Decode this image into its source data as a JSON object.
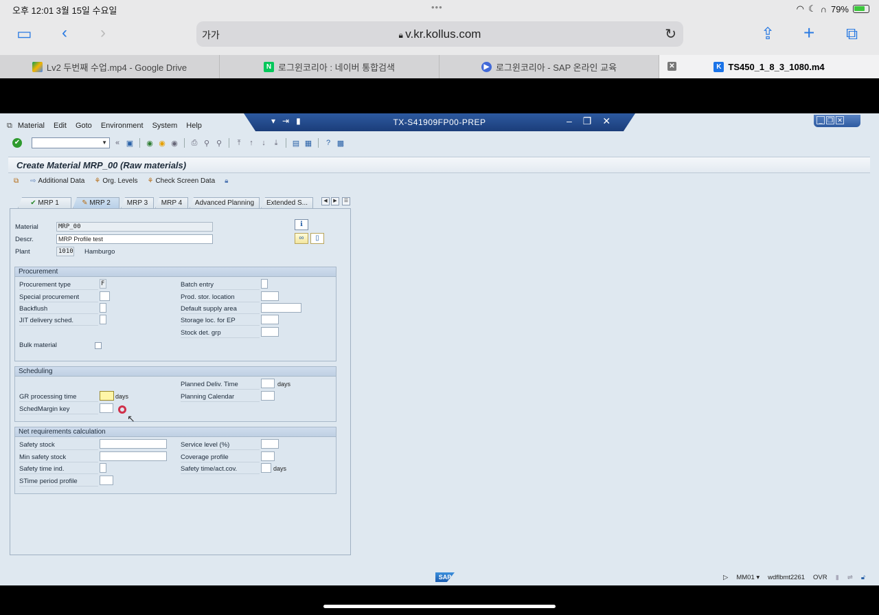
{
  "ios": {
    "time_date": "오후 12:01   3월 15일 수요일",
    "dots": "•••",
    "battery": "79%",
    "battery_level": 0.79,
    "url": "v.kr.kollus.com",
    "aa": "가가"
  },
  "browser_tabs": [
    {
      "label": "Lv2 두번째 수업.mp4 - Google Drive",
      "icon": "google-drive-icon"
    },
    {
      "label": "로그윈코리아 : 네이버 통합검색",
      "icon": "naver-icon"
    },
    {
      "label": "로그윈코리아 - SAP 온라인 교육",
      "icon": "play-icon"
    },
    {
      "label": "TS450_1_8_3_1080.m4",
      "icon": "kollus-icon",
      "active": true
    }
  ],
  "sap": {
    "window_title": "TX-S41909FP00-PREP",
    "menu": [
      "Material",
      "Edit",
      "Goto",
      "Environment",
      "System",
      "Help"
    ],
    "screen_title": "Create Material MRP_00 (Raw materials)",
    "app_toolbar": {
      "additional_data": "Additional Data",
      "org_levels": "Org. Levels",
      "check_screen_data": "Check Screen Data"
    },
    "tabs": [
      "MRP 1",
      "MRP 2",
      "MRP 3",
      "MRP 4",
      "Advanced Planning",
      "Extended S..."
    ],
    "header": {
      "material_label": "Material",
      "material_value": "MRP_00",
      "descr_label": "Descr.",
      "descr_value": "MRP Profile test",
      "plant_label": "Plant",
      "plant_value": "1010",
      "plant_name": "Hamburgo"
    },
    "procurement": {
      "title": "Procurement",
      "procurement_type": "Procurement type",
      "procurement_type_value": "F",
      "special_procurement": "Special procurement",
      "backflush": "Backflush",
      "jit": "JIT delivery sched.",
      "bulk": "Bulk material",
      "batch_entry": "Batch entry",
      "prod_stor": "Prod. stor. location",
      "default_supply": "Default supply area",
      "storage_ep": "Storage loc. for EP",
      "stock_det": "Stock det. grp"
    },
    "scheduling": {
      "title": "Scheduling",
      "gr_time": "GR processing time",
      "sched_margin": "SchedMargin key",
      "planned_deliv": "Planned Deliv. Time",
      "planning_calendar": "Planning Calendar",
      "days": "days"
    },
    "net_req": {
      "title": "Net requirements calculation",
      "safety_stock": "Safety stock",
      "min_safety": "Min safety stock",
      "safety_time_ind": "Safety time ind.",
      "stime_period": "STime period profile",
      "service_level": "Service level (%)",
      "coverage": "Coverage profile",
      "safety_time_cov": "Safety time/act.cov.",
      "days": "days"
    },
    "status": {
      "logo": "SAP",
      "transaction": "MM01",
      "server": "wdflbmt2261",
      "mode": "OVR"
    }
  }
}
